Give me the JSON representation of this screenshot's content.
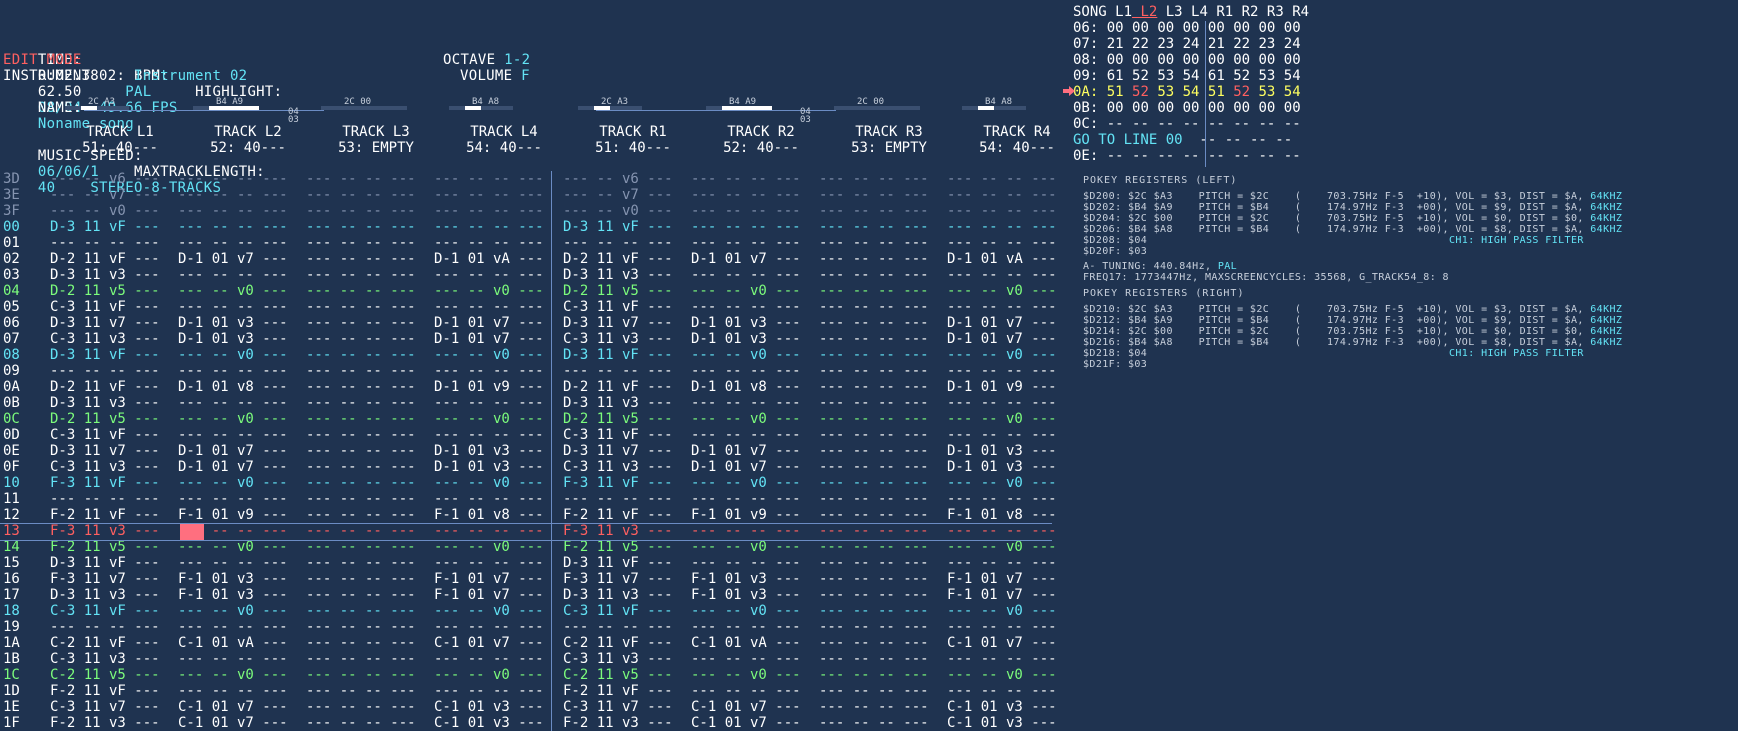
{
  "header": {
    "time_label": "TIME:",
    "time_value": "0:02.38",
    "bpm_label": "BPM:",
    "bpm_value": "62.50",
    "standard": "PAL",
    "highlight_label": "HIGHLIGHT:",
    "highlight_value": "08/04",
    "fps": "49.66 FPS",
    "name_label": "NAME:",
    "name_value": "Noname song",
    "speed_label": "MUSIC SPEED:",
    "speed_value": "06/06/1",
    "maxtrack_label": "MAXTRACKLENGTH:",
    "maxtrack_value": "40",
    "mode_value": "STEREO-8-TRACKS",
    "edit_mode": "EDIT MODE",
    "octave_label": "OCTAVE",
    "octave_value": "1-2",
    "instrument_label": "INSTRUMENT 02:",
    "instrument_value": "Instrument 02",
    "volume_label": "VOLUME",
    "volume_value": "F"
  },
  "tracks": [
    {
      "name": "TRACK L1",
      "info": "51: 40---",
      "tag1": "2C",
      "tag2": "A3"
    },
    {
      "name": "TRACK L2",
      "info": "52: 40---",
      "tag1": "B4",
      "tag2": "A9"
    },
    {
      "name": "TRACK L3",
      "info": "53: EMPTY",
      "tag1": "2C",
      "tag2": "00"
    },
    {
      "name": "TRACK L4",
      "info": "54: 40---",
      "tag1": "B4",
      "tag2": "A8"
    },
    {
      "name": "TRACK R1",
      "info": "51: 40---",
      "tag1": "2C",
      "tag2": "A3"
    },
    {
      "name": "TRACK R2",
      "info": "52: 40---",
      "tag1": "B4",
      "tag2": "A9"
    },
    {
      "name": "TRACK R3",
      "info": "53: EMPTY",
      "tag1": "2C",
      "tag2": "00"
    },
    {
      "name": "TRACK R4",
      "info": "54: 40---",
      "tag1": "B4",
      "tag2": "A8"
    }
  ],
  "mid_tags": [
    {
      "a": "04",
      "b": "03"
    },
    {
      "a": "04",
      "b": "03"
    }
  ],
  "rows": [
    {
      "n": "3D",
      "style": "pre",
      "c": [
        "--- -- v6 ---",
        "--- -- -- ---",
        "--- -- -- ---",
        "--- -- -- ---",
        "--- -- v6 ---",
        "--- -- -- ---",
        "--- -- -- ---",
        "--- -- -- ---"
      ]
    },
    {
      "n": "3E",
      "style": "pre",
      "c": [
        "--- -- v7 ---",
        "--- -- -- ---",
        "--- -- -- ---",
        "--- -- -- ---",
        "--- -- v7 ---",
        "--- -- -- ---",
        "--- -- -- ---",
        "--- -- -- ---"
      ]
    },
    {
      "n": "3F",
      "style": "pre",
      "c": [
        "--- -- v0 ---",
        "--- -- -- ---",
        "--- -- -- ---",
        "--- -- -- ---",
        "--- -- v0 ---",
        "--- -- -- ---",
        "--- -- -- ---",
        "--- -- -- ---"
      ]
    },
    {
      "n": "00",
      "style": "hl8",
      "c": [
        "D-3 11 vF ---",
        "--- -- -- ---",
        "--- -- -- ---",
        "--- -- -- ---",
        "D-3 11 vF ---",
        "--- -- -- ---",
        "--- -- -- ---",
        "--- -- -- ---"
      ]
    },
    {
      "n": "01",
      "style": "n",
      "c": [
        "--- -- -- ---",
        "--- -- -- ---",
        "--- -- -- ---",
        "--- -- -- ---",
        "--- -- -- ---",
        "--- -- -- ---",
        "--- -- -- ---",
        "--- -- -- ---"
      ]
    },
    {
      "n": "02",
      "style": "n",
      "c": [
        "D-2 11 vF ---",
        "D-1 01 v7 ---",
        "--- -- -- ---",
        "D-1 01 vA ---",
        "D-2 11 vF ---",
        "D-1 01 v7 ---",
        "--- -- -- ---",
        "D-1 01 vA ---"
      ]
    },
    {
      "n": "03",
      "style": "n",
      "c": [
        "D-3 11 v3 ---",
        "--- -- -- ---",
        "--- -- -- ---",
        "--- -- -- ---",
        "D-3 11 v3 ---",
        "--- -- -- ---",
        "--- -- -- ---",
        "--- -- -- ---"
      ]
    },
    {
      "n": "04",
      "style": "hl4",
      "c": [
        "D-2 11 v5 ---",
        "--- -- v0 ---",
        "--- -- -- ---",
        "--- -- v0 ---",
        "D-2 11 v5 ---",
        "--- -- v0 ---",
        "--- -- -- ---",
        "--- -- v0 ---"
      ]
    },
    {
      "n": "05",
      "style": "n",
      "c": [
        "C-3 11 vF ---",
        "--- -- -- ---",
        "--- -- -- ---",
        "--- -- -- ---",
        "C-3 11 vF ---",
        "--- -- -- ---",
        "--- -- -- ---",
        "--- -- -- ---"
      ]
    },
    {
      "n": "06",
      "style": "n",
      "c": [
        "D-3 11 v7 ---",
        "D-1 01 v3 ---",
        "--- -- -- ---",
        "D-1 01 v7 ---",
        "D-3 11 v7 ---",
        "D-1 01 v3 ---",
        "--- -- -- ---",
        "D-1 01 v7 ---"
      ]
    },
    {
      "n": "07",
      "style": "n",
      "c": [
        "C-3 11 v3 ---",
        "D-1 01 v3 ---",
        "--- -- -- ---",
        "D-1 01 v7 ---",
        "C-3 11 v3 ---",
        "D-1 01 v3 ---",
        "--- -- -- ---",
        "D-1 01 v7 ---"
      ]
    },
    {
      "n": "08",
      "style": "hl8",
      "c": [
        "D-3 11 vF ---",
        "--- -- v0 ---",
        "--- -- -- ---",
        "--- -- v0 ---",
        "D-3 11 vF ---",
        "--- -- v0 ---",
        "--- -- -- ---",
        "--- -- v0 ---"
      ]
    },
    {
      "n": "09",
      "style": "n",
      "c": [
        "--- -- -- ---",
        "--- -- -- ---",
        "--- -- -- ---",
        "--- -- -- ---",
        "--- -- -- ---",
        "--- -- -- ---",
        "--- -- -- ---",
        "--- -- -- ---"
      ]
    },
    {
      "n": "0A",
      "style": "n",
      "c": [
        "D-2 11 vF ---",
        "D-1 01 v8 ---",
        "--- -- -- ---",
        "D-1 01 v9 ---",
        "D-2 11 vF ---",
        "D-1 01 v8 ---",
        "--- -- -- ---",
        "D-1 01 v9 ---"
      ]
    },
    {
      "n": "0B",
      "style": "n",
      "c": [
        "D-3 11 v3 ---",
        "--- -- -- ---",
        "--- -- -- ---",
        "--- -- -- ---",
        "D-3 11 v3 ---",
        "--- -- -- ---",
        "--- -- -- ---",
        "--- -- -- ---"
      ]
    },
    {
      "n": "0C",
      "style": "hl4",
      "c": [
        "D-2 11 v5 ---",
        "--- -- v0 ---",
        "--- -- -- ---",
        "--- -- v0 ---",
        "D-2 11 v5 ---",
        "--- -- v0 ---",
        "--- -- -- ---",
        "--- -- v0 ---"
      ]
    },
    {
      "n": "0D",
      "style": "n",
      "c": [
        "C-3 11 vF ---",
        "--- -- -- ---",
        "--- -- -- ---",
        "--- -- -- ---",
        "C-3 11 vF ---",
        "--- -- -- ---",
        "--- -- -- ---",
        "--- -- -- ---"
      ]
    },
    {
      "n": "0E",
      "style": "n",
      "c": [
        "D-3 11 v7 ---",
        "D-1 01 v7 ---",
        "--- -- -- ---",
        "D-1 01 v3 ---",
        "D-3 11 v7 ---",
        "D-1 01 v7 ---",
        "--- -- -- ---",
        "D-1 01 v3 ---"
      ]
    },
    {
      "n": "0F",
      "style": "n",
      "c": [
        "C-3 11 v3 ---",
        "D-1 01 v7 ---",
        "--- -- -- ---",
        "D-1 01 v3 ---",
        "C-3 11 v3 ---",
        "D-1 01 v7 ---",
        "--- -- -- ---",
        "D-1 01 v3 ---"
      ]
    },
    {
      "n": "10",
      "style": "hl8",
      "c": [
        "F-3 11 vF ---",
        "--- -- v0 ---",
        "--- -- -- ---",
        "--- -- v0 ---",
        "F-3 11 vF ---",
        "--- -- v0 ---",
        "--- -- -- ---",
        "--- -- v0 ---"
      ]
    },
    {
      "n": "11",
      "style": "n",
      "c": [
        "--- -- -- ---",
        "--- -- -- ---",
        "--- -- -- ---",
        "--- -- -- ---",
        "--- -- -- ---",
        "--- -- -- ---",
        "--- -- -- ---",
        "--- -- -- ---"
      ]
    },
    {
      "n": "12",
      "style": "n",
      "c": [
        "F-2 11 vF ---",
        "F-1 01 v9 ---",
        "--- -- -- ---",
        "F-1 01 v8 ---",
        "F-2 11 vF ---",
        "F-1 01 v9 ---",
        "--- -- -- ---",
        "F-1 01 v8 ---"
      ]
    },
    {
      "n": "13",
      "style": "cur",
      "c": [
        "F-3 11 v3 ---",
        "--- -- -- ---",
        "--- -- -- ---",
        "--- -- -- ---",
        "F-3 11 v3 ---",
        "--- -- -- ---",
        "--- -- -- ---",
        "--- -- -- ---"
      ]
    },
    {
      "n": "14",
      "style": "hl4",
      "c": [
        "F-2 11 v5 ---",
        "--- -- v0 ---",
        "--- -- -- ---",
        "--- -- v0 ---",
        "F-2 11 v5 ---",
        "--- -- v0 ---",
        "--- -- -- ---",
        "--- -- v0 ---"
      ]
    },
    {
      "n": "15",
      "style": "n",
      "c": [
        "D-3 11 vF ---",
        "--- -- -- ---",
        "--- -- -- ---",
        "--- -- -- ---",
        "D-3 11 vF ---",
        "--- -- -- ---",
        "--- -- -- ---",
        "--- -- -- ---"
      ]
    },
    {
      "n": "16",
      "style": "n",
      "c": [
        "F-3 11 v7 ---",
        "F-1 01 v3 ---",
        "--- -- -- ---",
        "F-1 01 v7 ---",
        "F-3 11 v7 ---",
        "F-1 01 v3 ---",
        "--- -- -- ---",
        "F-1 01 v7 ---"
      ]
    },
    {
      "n": "17",
      "style": "n",
      "c": [
        "D-3 11 v3 ---",
        "F-1 01 v3 ---",
        "--- -- -- ---",
        "F-1 01 v7 ---",
        "D-3 11 v3 ---",
        "F-1 01 v3 ---",
        "--- -- -- ---",
        "F-1 01 v7 ---"
      ]
    },
    {
      "n": "18",
      "style": "hl8",
      "c": [
        "C-3 11 vF ---",
        "--- -- v0 ---",
        "--- -- -- ---",
        "--- -- v0 ---",
        "C-3 11 vF ---",
        "--- -- v0 ---",
        "--- -- -- ---",
        "--- -- v0 ---"
      ]
    },
    {
      "n": "19",
      "style": "n",
      "c": [
        "--- -- -- ---",
        "--- -- -- ---",
        "--- -- -- ---",
        "--- -- -- ---",
        "--- -- -- ---",
        "--- -- -- ---",
        "--- -- -- ---",
        "--- -- -- ---"
      ]
    },
    {
      "n": "1A",
      "style": "n",
      "c": [
        "C-2 11 vF ---",
        "C-1 01 vA ---",
        "--- -- -- ---",
        "C-1 01 v7 ---",
        "C-2 11 vF ---",
        "C-1 01 vA ---",
        "--- -- -- ---",
        "C-1 01 v7 ---"
      ]
    },
    {
      "n": "1B",
      "style": "n",
      "c": [
        "C-3 11 v3 ---",
        "--- -- -- ---",
        "--- -- -- ---",
        "--- -- -- ---",
        "C-3 11 v3 ---",
        "--- -- -- ---",
        "--- -- -- ---",
        "--- -- -- ---"
      ]
    },
    {
      "n": "1C",
      "style": "hl4",
      "c": [
        "C-2 11 v5 ---",
        "--- -- v0 ---",
        "--- -- -- ---",
        "--- -- v0 ---",
        "C-2 11 v5 ---",
        "--- -- v0 ---",
        "--- -- -- ---",
        "--- -- v0 ---"
      ]
    },
    {
      "n": "1D",
      "style": "n",
      "c": [
        "F-2 11 vF ---",
        "--- -- -- ---",
        "--- -- -- ---",
        "--- -- -- ---",
        "F-2 11 vF ---",
        "--- -- -- ---",
        "--- -- -- ---",
        "--- -- -- ---"
      ]
    },
    {
      "n": "1E",
      "style": "n",
      "c": [
        "C-3 11 v7 ---",
        "C-1 01 v7 ---",
        "--- -- -- ---",
        "C-1 01 v3 ---",
        "C-3 11 v7 ---",
        "C-1 01 v7 ---",
        "--- -- -- ---",
        "C-1 01 v3 ---"
      ]
    },
    {
      "n": "1F",
      "style": "n",
      "c": [
        "F-2 11 v3 ---",
        "C-1 01 v7 ---",
        "--- -- -- ---",
        "C-1 01 v3 ---",
        "F-2 11 v3 ---",
        "C-1 01 v7 ---",
        "--- -- -- ---",
        "C-1 01 v3 ---"
      ]
    }
  ],
  "song": {
    "header": [
      "SONG",
      "L1",
      "L2",
      "L3",
      "L4",
      "R1",
      "R2",
      "R3",
      "R4"
    ],
    "active_header": "L2",
    "rows": [
      {
        "n": "06:",
        "v": [
          "00",
          "00",
          "00",
          "00",
          "00",
          "00",
          "00",
          "00"
        ],
        "style": "n"
      },
      {
        "n": "07:",
        "v": [
          "21",
          "22",
          "23",
          "24",
          "21",
          "22",
          "23",
          "24"
        ],
        "style": "n"
      },
      {
        "n": "08:",
        "v": [
          "00",
          "00",
          "00",
          "00",
          "00",
          "00",
          "00",
          "00"
        ],
        "style": "n"
      },
      {
        "n": "09:",
        "v": [
          "61",
          "52",
          "53",
          "54",
          "61",
          "52",
          "53",
          "54"
        ],
        "style": "n"
      },
      {
        "n": "0A:",
        "v": [
          "51",
          "52",
          "53",
          "54",
          "51",
          "52",
          "53",
          "54"
        ],
        "style": "cur"
      },
      {
        "n": "0B:",
        "v": [
          "00",
          "00",
          "00",
          "00",
          "00",
          "00",
          "00",
          "00"
        ],
        "style": "n"
      },
      {
        "n": "0C:",
        "v": [
          "--",
          "--",
          "--",
          "--",
          "--",
          "--",
          "--",
          "--"
        ],
        "style": "n"
      },
      {
        "n": "0E:",
        "v": [
          "--",
          "--",
          "--",
          "--",
          "--",
          "--",
          "--",
          "--"
        ],
        "style": "n"
      }
    ],
    "goto_label": "GO TO LINE",
    "goto_value": "00",
    "goto_rest": "-- -- -- --"
  },
  "pokey": {
    "left_title": "POKEY REGISTERS (LEFT)",
    "left": [
      "$D200: $2C $A3    PITCH = $2C    (    703.75Hz F-5  +10), VOL = $3, DIST = $A, ",
      "$D202: $B4 $A9    PITCH = $B4    (    174.97Hz F-3  +00), VOL = $9, DIST = $A, ",
      "$D204: $2C $00    PITCH = $2C    (    703.75Hz F-5  +10), VOL = $0, DIST = $0, ",
      "$D206: $B4 $A8    PITCH = $B4    (    174.97Hz F-3  +00), VOL = $8, DIST = $A, ",
      "$D208: $04                                               ",
      "$D20F: $03"
    ],
    "left_khz": [
      "64KHZ",
      "64KHZ",
      "64KHZ",
      "64KHZ"
    ],
    "left_filter": "CH1: HIGH PASS FILTER",
    "tuning_label": "A- TUNING: 440.84Hz,",
    "tuning_std": "PAL",
    "freq_line": "FREQ17: 1773447Hz, MAXSCREENCYCLES: 35568, G_TRACK54_8: 8",
    "right_title": "POKEY REGISTERS (RIGHT)",
    "right": [
      "$D210: $2C $A3    PITCH = $2C    (    703.75Hz F-5  +10), VOL = $3, DIST = $A, ",
      "$D212: $B4 $A9    PITCH = $B4    (    174.97Hz F-3  +00), VOL = $9, DIST = $A, ",
      "$D214: $2C $00    PITCH = $2C    (    703.75Hz F-5  +10), VOL = $0, DIST = $0, ",
      "$D216: $B4 $A8    PITCH = $B4    (    174.97Hz F-3  +00), VOL = $8, DIST = $A, ",
      "$D218: $04                                               ",
      "$D21F: $03"
    ],
    "right_khz": [
      "64KHZ",
      "64KHZ",
      "64KHZ",
      "64KHZ"
    ],
    "right_filter": "CH1: HIGH PASS FILTER"
  },
  "colors": {
    "background": "#1f3350",
    "accent_cyan": "#63e3f5",
    "accent_red": "#ff6060",
    "accent_yellow": "#ffff60",
    "accent_green": "#7cfc7c"
  },
  "icons": {
    "song_cursor": "arrow-right-icon"
  }
}
